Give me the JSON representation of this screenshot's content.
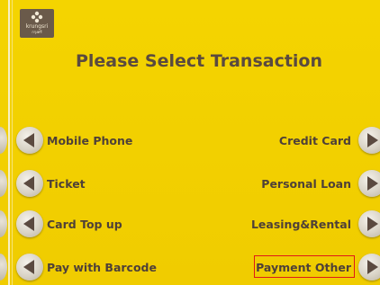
{
  "brand": {
    "name": "krungsri",
    "sub": "กรุงศรี"
  },
  "title": "Please Select Transaction",
  "left_options": [
    {
      "label": "Mobile Phone"
    },
    {
      "label": "Ticket"
    },
    {
      "label": "Card Top up"
    },
    {
      "label": "Pay with Barcode"
    }
  ],
  "right_options": [
    {
      "label": "Credit Card"
    },
    {
      "label": "Personal Loan"
    },
    {
      "label": "Leasing&Rental"
    },
    {
      "label": "Payment Other"
    }
  ],
  "colors": {
    "background": "#f3d000",
    "text": "#4e4038",
    "highlight": "#e01818",
    "logo_bg": "#6a5a4a"
  },
  "icons": {
    "left_button": "triangle-left-icon",
    "right_button": "triangle-right-icon",
    "logo": "krungsri-logo-icon"
  },
  "highlighted_option": "Payment Other"
}
